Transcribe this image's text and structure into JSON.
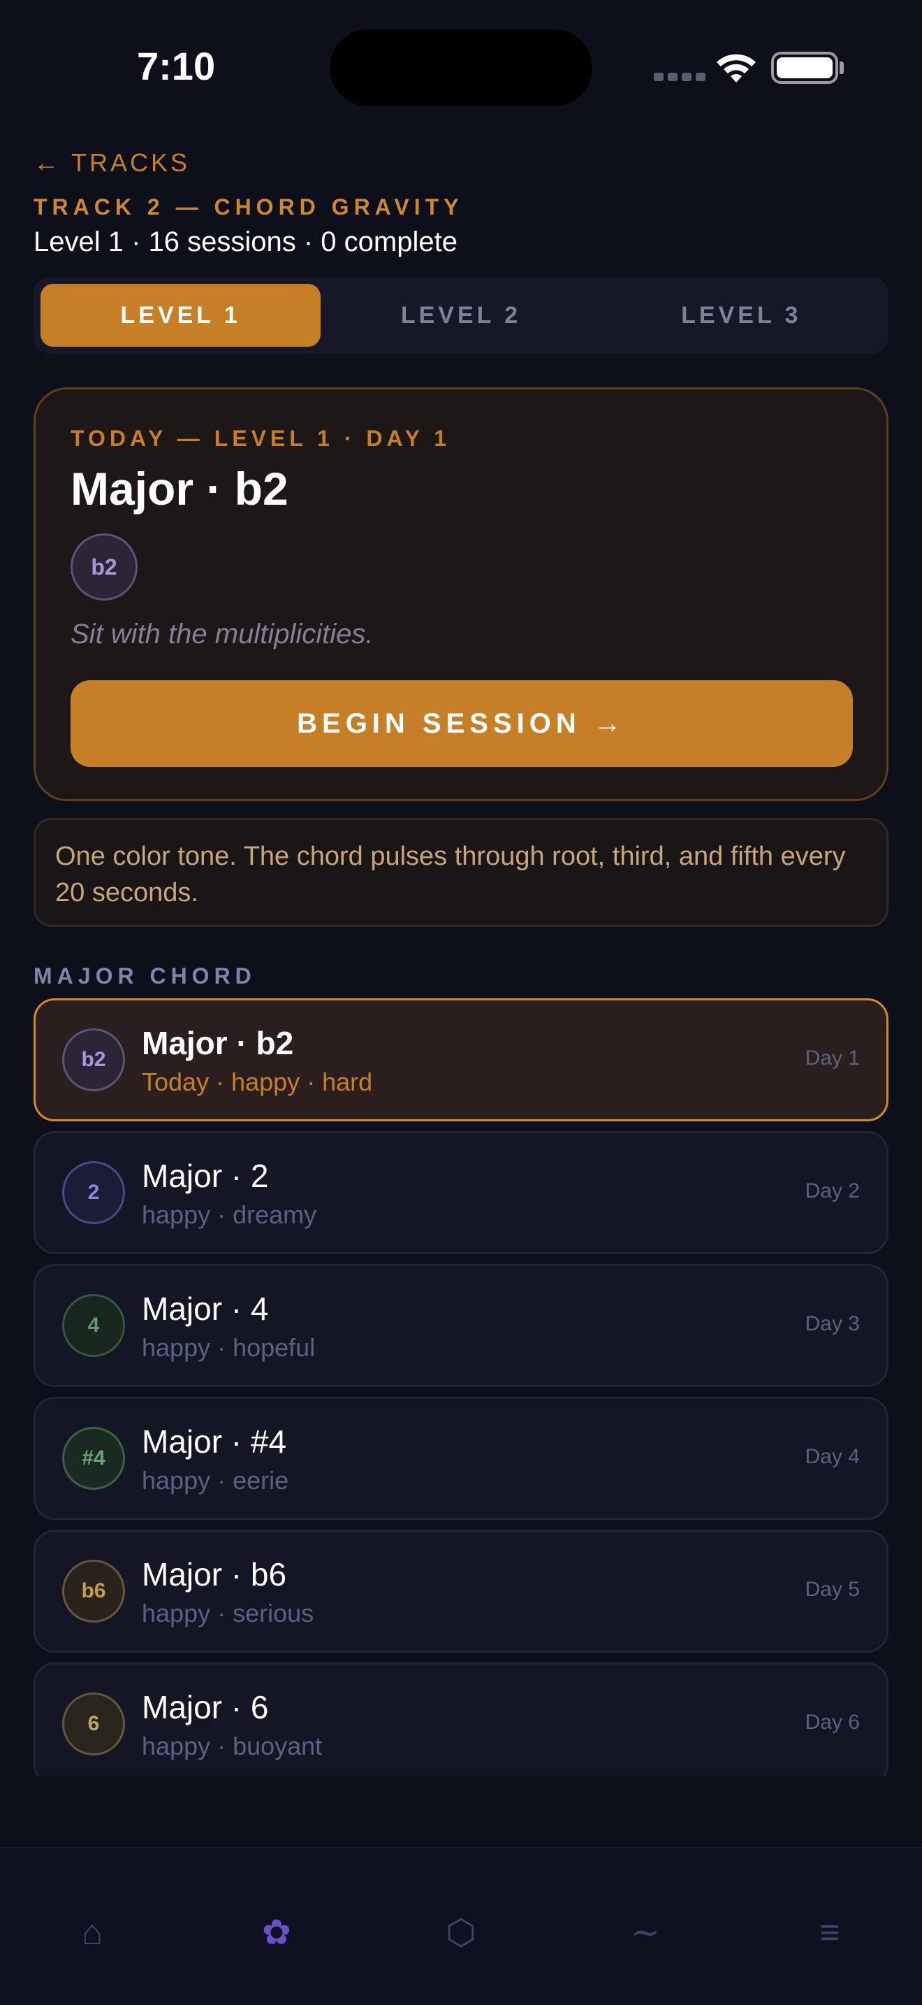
{
  "status": {
    "time": "7:10"
  },
  "nav": {
    "back_arrow": "←",
    "back_label": "TRACKS"
  },
  "header": {
    "track_title": "TRACK 2 — CHORD GRAVITY",
    "subtitle": "Level 1 · 16 sessions · 0 complete"
  },
  "levels": [
    {
      "label": "LEVEL 1",
      "active": true
    },
    {
      "label": "LEVEL 2",
      "active": false
    },
    {
      "label": "LEVEL 3",
      "active": false
    }
  ],
  "today": {
    "label": "TODAY — LEVEL 1 · DAY 1",
    "title": "Major · b2",
    "badge": "b2",
    "quote": "Sit with the multiplicities.",
    "button": "BEGIN SESSION →"
  },
  "description": "One color tone. The chord pulses through root, third, and fifth every 20 seconds.",
  "section_label": "MAJOR CHORD",
  "sessions": [
    {
      "badge": "b2",
      "title": "Major · b2",
      "sub": "Today · happy · hard",
      "day": "Day 1",
      "active": true,
      "color": "#a898d6",
      "bg": "#2c2538",
      "border": "#5d5376"
    },
    {
      "badge": "2",
      "title": "Major · 2",
      "sub": "happy · dreamy",
      "day": "Day 2",
      "active": false,
      "color": "#8e86e0",
      "bg": "#1d1c36",
      "border": "#4b4787"
    },
    {
      "badge": "4",
      "title": "Major · 4",
      "sub": "happy · hopeful",
      "day": "Day 3",
      "active": false,
      "color": "#5e9a6b",
      "bg": "#19261f",
      "border": "#2f5a3c"
    },
    {
      "badge": "#4",
      "title": "Major · #4",
      "sub": "happy · eerie",
      "day": "Day 4",
      "active": false,
      "color": "#6aa675",
      "bg": "#1a2a22",
      "border": "#376344"
    },
    {
      "badge": "b6",
      "title": "Major · b6",
      "sub": "happy · serious",
      "day": "Day 5",
      "active": false,
      "color": "#c79a55",
      "bg": "#2a231b",
      "border": "#6a5536"
    },
    {
      "badge": "6",
      "title": "Major · 6",
      "sub": "happy · buoyant",
      "day": "Day 6",
      "active": false,
      "color": "#c3a566",
      "bg": "#29251c",
      "border": "#63563a"
    }
  ],
  "tabbar": [
    {
      "icon": "home-icon",
      "glyph": "⌂",
      "active": false
    },
    {
      "icon": "flower-icon",
      "glyph": "✿",
      "active": true
    },
    {
      "icon": "hexagon-icon",
      "glyph": "⬡",
      "active": false
    },
    {
      "icon": "wave-icon",
      "glyph": "∼",
      "active": false
    },
    {
      "icon": "menu-icon",
      "glyph": "≡",
      "active": false
    }
  ]
}
